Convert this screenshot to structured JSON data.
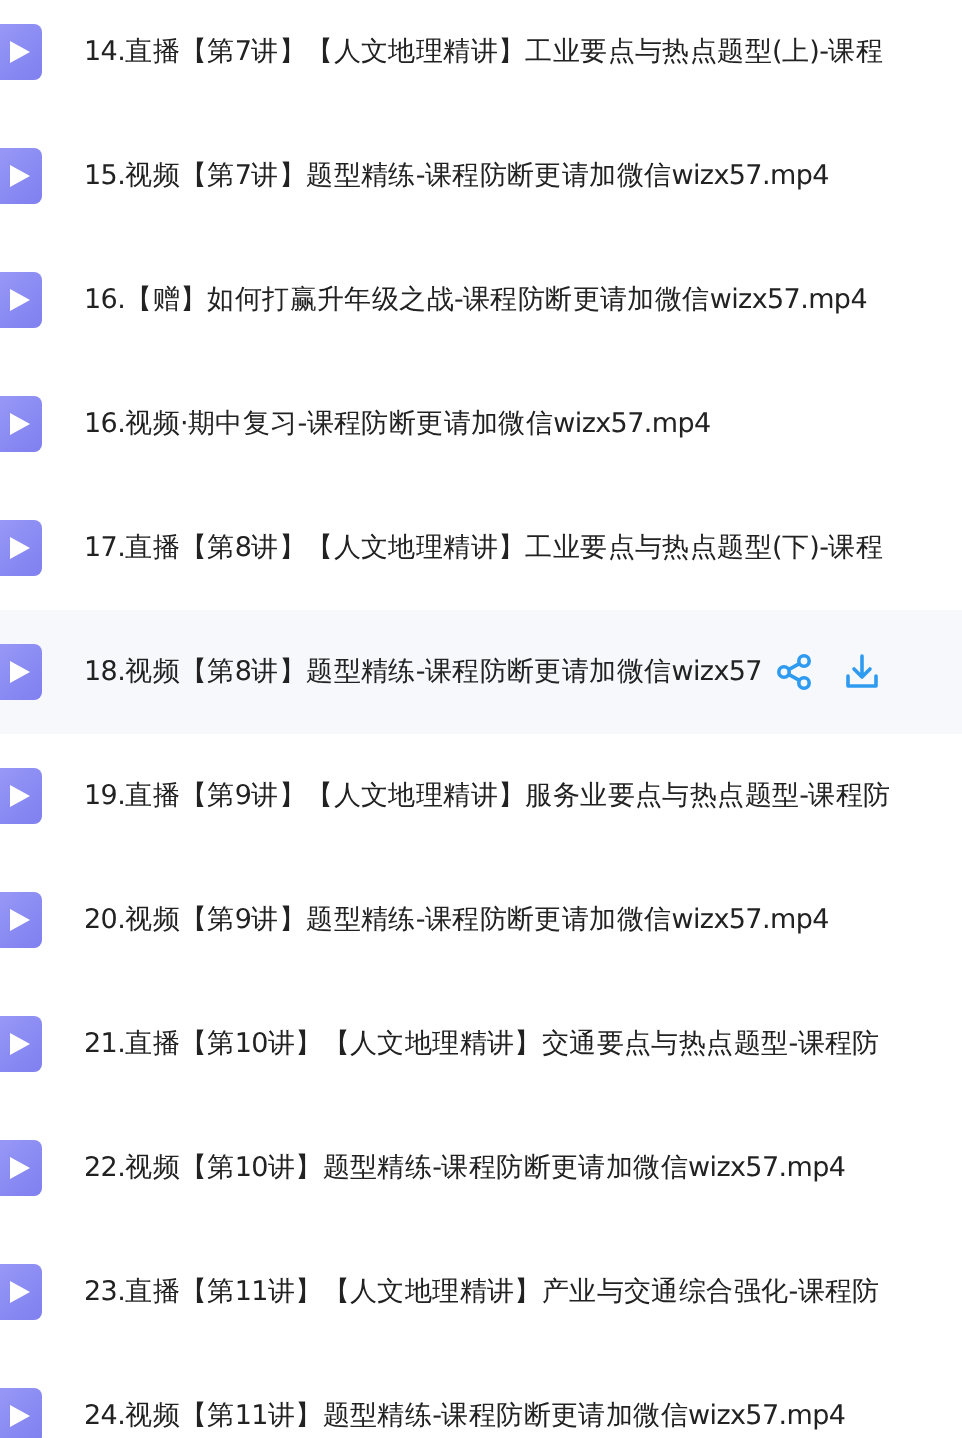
{
  "files": [
    {
      "name": "14.直播【第7讲】【人文地理精讲】工业要点与热点题型(上)-课程",
      "highlighted": false
    },
    {
      "name": "15.视频【第7讲】题型精练-课程防断更请加微信wizx57.mp4",
      "highlighted": false
    },
    {
      "name": "16.【赠】如何打赢升年级之战-课程防断更请加微信wizx57.mp4",
      "highlighted": false
    },
    {
      "name": "16.视频·期中复习-课程防断更请加微信wizx57.mp4",
      "highlighted": false
    },
    {
      "name": "17.直播【第8讲】【人文地理精讲】工业要点与热点题型(下)-课程",
      "highlighted": false
    },
    {
      "name": "18.视频【第8讲】题型精练-课程防断更请加微信wizx57",
      "highlighted": true
    },
    {
      "name": "19.直播【第9讲】【人文地理精讲】服务业要点与热点题型-课程防",
      "highlighted": false
    },
    {
      "name": "20.视频【第9讲】题型精练-课程防断更请加微信wizx57.mp4",
      "highlighted": false
    },
    {
      "name": "21.直播【第10讲】【人文地理精讲】交通要点与热点题型-课程防",
      "highlighted": false
    },
    {
      "name": "22.视频【第10讲】题型精练-课程防断更请加微信wizx57.mp4",
      "highlighted": false
    },
    {
      "name": "23.直播【第11讲】【人文地理精讲】产业与交通综合强化-课程防",
      "highlighted": false
    },
    {
      "name": "24.视频【第11讲】题型精练-课程防断更请加微信wizx57.mp4",
      "highlighted": false
    }
  ]
}
